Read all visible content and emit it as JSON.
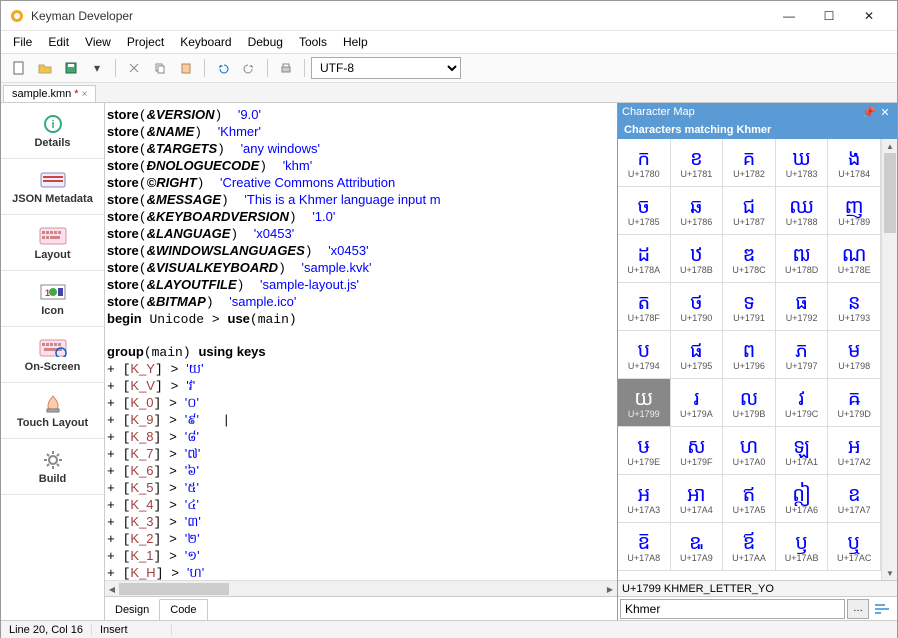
{
  "window": {
    "title": "Keyman Developer"
  },
  "menubar": [
    "File",
    "Edit",
    "View",
    "Project",
    "Keyboard",
    "Debug",
    "Tools",
    "Help"
  ],
  "toolbar": {
    "encoding": "UTF-8"
  },
  "tabstrip": {
    "filename": "sample.kmn",
    "dirty": "*"
  },
  "sidebar": {
    "items": [
      {
        "label": "Details"
      },
      {
        "label": "JSON Metadata"
      },
      {
        "label": "Layout"
      },
      {
        "label": "Icon"
      },
      {
        "label": "On-Screen"
      },
      {
        "label": "Touch Layout"
      },
      {
        "label": "Build"
      }
    ]
  },
  "editor": {
    "lines_store": [
      {
        "name": "&VERSION",
        "val": "'9.0'"
      },
      {
        "name": "&NAME",
        "val": "'Khmer'"
      },
      {
        "name": "&TARGETS",
        "val": "'any windows'"
      },
      {
        "name": "&ETHNOLOGUECODE",
        "val": "'khm'"
      },
      {
        "name": "&COPYRIGHT",
        "val": "'Creative Commons Attribution "
      },
      {
        "name": "&MESSAGE",
        "val": "'This is a Khmer language input m"
      },
      {
        "name": "&KEYBOARDVERSION",
        "val": "'1.0'"
      },
      {
        "name": "&LANGUAGE",
        "val": "'x0453'"
      },
      {
        "name": "&WINDOWSLANGUAGES",
        "val": "'x0453'"
      },
      {
        "name": "&VISUALKEYBOARD",
        "val": "'sample.kvk'"
      },
      {
        "name": "&LAYOUTFILE",
        "val": "'sample-layout.js'"
      },
      {
        "name": "&BITMAP",
        "val": "'sample.ico'"
      }
    ],
    "begin_line": "begin Unicode > use(main)",
    "group_line": "group(main) using keys",
    "rules": [
      {
        "vk": "K_Y",
        "out": "'យ'"
      },
      {
        "vk": "K_V",
        "out": "'វ'"
      },
      {
        "vk": "K_0",
        "out": "'០'"
      },
      {
        "vk": "K_9",
        "out": "'៩'",
        "cursor": true
      },
      {
        "vk": "K_8",
        "out": "'៨'"
      },
      {
        "vk": "K_7",
        "out": "'៧'"
      },
      {
        "vk": "K_6",
        "out": "'៦'"
      },
      {
        "vk": "K_5",
        "out": "'៥'"
      },
      {
        "vk": "K_4",
        "out": "'៤'"
      },
      {
        "vk": "K_3",
        "out": "'៣'"
      },
      {
        "vk": "K_2",
        "out": "'២'"
      },
      {
        "vk": "K_1",
        "out": "'១'"
      },
      {
        "vk": "K_H",
        "out": "'ហ'"
      }
    ]
  },
  "bottomtabs": {
    "design": "Design",
    "code": "Code"
  },
  "charmap": {
    "title": "Character Map",
    "subtitle": "Characters matching Khmer",
    "cells": [
      {
        "g": "ក",
        "c": "U+1780"
      },
      {
        "g": "ខ",
        "c": "U+1781"
      },
      {
        "g": "គ",
        "c": "U+1782"
      },
      {
        "g": "ឃ",
        "c": "U+1783"
      },
      {
        "g": "ង",
        "c": "U+1784"
      },
      {
        "g": "ច",
        "c": "U+1785"
      },
      {
        "g": "ឆ",
        "c": "U+1786"
      },
      {
        "g": "ជ",
        "c": "U+1787"
      },
      {
        "g": "ឈ",
        "c": "U+1788"
      },
      {
        "g": "ញ",
        "c": "U+1789"
      },
      {
        "g": "ដ",
        "c": "U+178A"
      },
      {
        "g": "ឋ",
        "c": "U+178B"
      },
      {
        "g": "ឌ",
        "c": "U+178C"
      },
      {
        "g": "ឍ",
        "c": "U+178D"
      },
      {
        "g": "ណ",
        "c": "U+178E"
      },
      {
        "g": "ត",
        "c": "U+178F"
      },
      {
        "g": "ថ",
        "c": "U+1790"
      },
      {
        "g": "ទ",
        "c": "U+1791"
      },
      {
        "g": "ធ",
        "c": "U+1792"
      },
      {
        "g": "ន",
        "c": "U+1793"
      },
      {
        "g": "ប",
        "c": "U+1794"
      },
      {
        "g": "ផ",
        "c": "U+1795"
      },
      {
        "g": "ព",
        "c": "U+1796"
      },
      {
        "g": "ភ",
        "c": "U+1797"
      },
      {
        "g": "ម",
        "c": "U+1798"
      },
      {
        "g": "យ",
        "c": "U+1799",
        "selected": true
      },
      {
        "g": "រ",
        "c": "U+179A"
      },
      {
        "g": "ល",
        "c": "U+179B"
      },
      {
        "g": "វ",
        "c": "U+179C"
      },
      {
        "g": "ឝ",
        "c": "U+179D"
      },
      {
        "g": "ឞ",
        "c": "U+179E"
      },
      {
        "g": "ស",
        "c": "U+179F"
      },
      {
        "g": "ហ",
        "c": "U+17A0"
      },
      {
        "g": "ឡ",
        "c": "U+17A1"
      },
      {
        "g": "អ",
        "c": "U+17A2"
      },
      {
        "g": "ឣ",
        "c": "U+17A3"
      },
      {
        "g": "ឤ",
        "c": "U+17A4"
      },
      {
        "g": "ឥ",
        "c": "U+17A5"
      },
      {
        "g": "ឦ",
        "c": "U+17A6"
      },
      {
        "g": "ឧ",
        "c": "U+17A7"
      },
      {
        "g": "ឨ",
        "c": "U+17A8"
      },
      {
        "g": "ឩ",
        "c": "U+17A9"
      },
      {
        "g": "ឪ",
        "c": "U+17AA"
      },
      {
        "g": "ឫ",
        "c": "U+17AB"
      },
      {
        "g": "ឬ",
        "c": "U+17AC"
      }
    ],
    "selected_info": "U+1799 KHMER_LETTER_YO",
    "search": "Khmer"
  },
  "statusbar": {
    "pos": "Line 20, Col 16",
    "mode": "Insert"
  }
}
